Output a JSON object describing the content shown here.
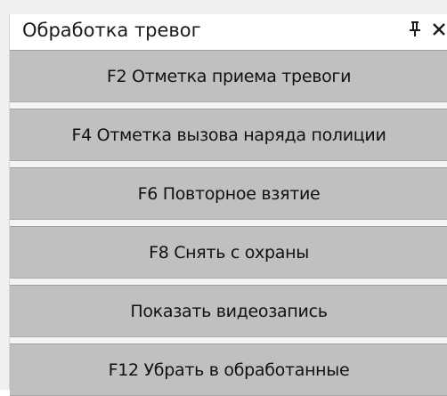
{
  "panel": {
    "title": "Обработка тревог",
    "pin_icon": "pin-icon",
    "close_icon": "close-icon"
  },
  "actions": [
    {
      "label": "F2 Отметка приема тревоги"
    },
    {
      "label": "F4 Отметка вызова наряда полиции"
    },
    {
      "label": "F6 Повторное взятие"
    },
    {
      "label": "F8 Снять с охраны"
    },
    {
      "label": "Показать видеозапись"
    },
    {
      "label": "F12 Убрать в обработанные"
    }
  ],
  "colors": {
    "button_bg": "#c0c0c0",
    "panel_bg": "#f0f0f0",
    "title_bg": "#ffffff"
  }
}
